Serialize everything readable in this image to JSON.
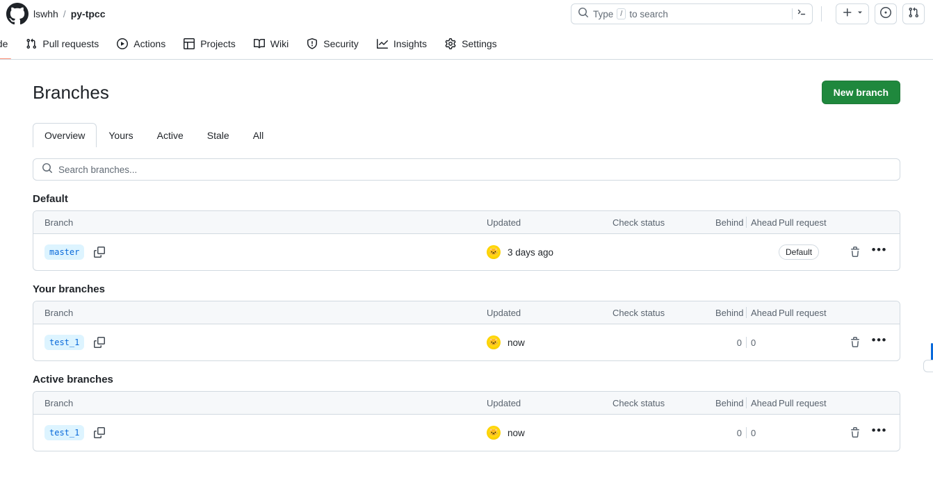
{
  "header": {
    "logo_icon": "github-mark-icon",
    "breadcrumb": {
      "owner": "lswhh",
      "separator": "/",
      "repo": "py-tpcc"
    },
    "search": {
      "placeholder_prefix": "Type",
      "slash_key": "/",
      "placeholder_suffix": "to search",
      "search_icon": "search-icon",
      "terminal_icon": "terminal-icon"
    },
    "actions": [
      {
        "name": "create-new-menu",
        "icon": "plus-icon",
        "caret": "chevron-down-icon"
      },
      {
        "name": "issues-button",
        "icon": "issue-opened-icon"
      },
      {
        "name": "pull-requests-button",
        "icon": "git-pull-request-icon"
      }
    ]
  },
  "repo_nav": {
    "items": [
      {
        "label": "ode",
        "icon": "code-icon",
        "active": true,
        "clipped": true
      },
      {
        "label": "Pull requests",
        "icon": "git-pull-request-icon",
        "active": false
      },
      {
        "label": "Actions",
        "icon": "play-icon",
        "active": false
      },
      {
        "label": "Projects",
        "icon": "table-icon",
        "active": false
      },
      {
        "label": "Wiki",
        "icon": "book-icon",
        "active": false
      },
      {
        "label": "Security",
        "icon": "shield-icon",
        "active": false
      },
      {
        "label": "Insights",
        "icon": "graph-icon",
        "active": false
      },
      {
        "label": "Settings",
        "icon": "gear-icon",
        "active": false
      }
    ]
  },
  "page": {
    "title": "Branches",
    "new_branch_label": "New branch",
    "accent_color": "#1f883d"
  },
  "tabs": [
    {
      "label": "Overview",
      "selected": true
    },
    {
      "label": "Yours",
      "selected": false
    },
    {
      "label": "Active",
      "selected": false
    },
    {
      "label": "Stale",
      "selected": false
    },
    {
      "label": "All",
      "selected": false
    }
  ],
  "branch_search": {
    "placeholder": "Search branches...",
    "icon": "search-icon"
  },
  "columns": {
    "branch": "Branch",
    "updated": "Updated",
    "check_status": "Check status",
    "behind": "Behind",
    "ahead": "Ahead",
    "pull_request": "Pull request"
  },
  "sections": [
    {
      "title": "Default",
      "rows": [
        {
          "branch": "master",
          "copy_icon": "copy-icon",
          "avatar": "user-avatar",
          "updated": "3 days ago",
          "check_status": "",
          "behind": "",
          "ahead": "",
          "show_behind_ahead": false,
          "pull_request": "Default",
          "is_default": true,
          "delete_icon": "trash-icon",
          "more_icon": "kebab-horizontal-icon"
        }
      ]
    },
    {
      "title": "Your branches",
      "rows": [
        {
          "branch": "test_1",
          "copy_icon": "copy-icon",
          "avatar": "user-avatar",
          "updated": "now",
          "check_status": "",
          "behind": "0",
          "ahead": "0",
          "show_behind_ahead": true,
          "pull_request": "",
          "is_default": false,
          "delete_icon": "trash-icon",
          "more_icon": "kebab-horizontal-icon"
        }
      ]
    },
    {
      "title": "Active branches",
      "rows": [
        {
          "branch": "test_1",
          "copy_icon": "copy-icon",
          "avatar": "user-avatar",
          "updated": "now",
          "check_status": "",
          "behind": "0",
          "ahead": "0",
          "show_behind_ahead": true,
          "pull_request": "",
          "is_default": false,
          "delete_icon": "trash-icon",
          "more_icon": "kebab-horizontal-icon"
        }
      ]
    }
  ]
}
